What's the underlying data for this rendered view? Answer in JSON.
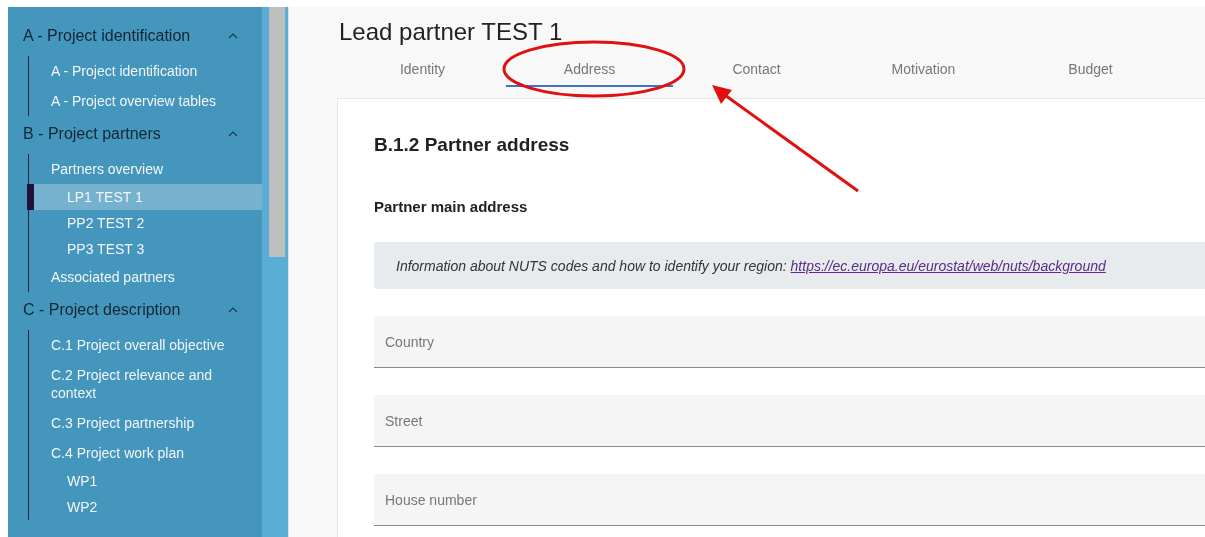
{
  "sidebar": {
    "groups": [
      {
        "label": "A - Project identification",
        "expanded": true,
        "items": [
          {
            "label": "A - Project identification",
            "selected": false
          },
          {
            "label": "A - Project overview tables",
            "selected": false
          }
        ]
      },
      {
        "label": "B - Project partners",
        "expanded": true,
        "items": [
          {
            "label": "Partners overview",
            "selected": false,
            "children": [
              {
                "label": "LP1 TEST 1",
                "selected": true
              },
              {
                "label": "PP2 TEST 2",
                "selected": false
              },
              {
                "label": "PP3 TEST 3",
                "selected": false
              }
            ]
          },
          {
            "label": "Associated partners",
            "selected": false
          }
        ]
      },
      {
        "label": "C - Project description",
        "expanded": true,
        "items": [
          {
            "label": "C.1 Project overall objective",
            "selected": false
          },
          {
            "label": "C.2 Project relevance and context",
            "selected": false
          },
          {
            "label": "C.3 Project partnership",
            "selected": false
          },
          {
            "label": "C.4 Project work plan",
            "selected": false,
            "children": [
              {
                "label": "WP1",
                "selected": false
              },
              {
                "label": "WP2",
                "selected": false
              }
            ]
          }
        ]
      }
    ]
  },
  "page": {
    "title": "Lead partner TEST 1",
    "tabs": [
      {
        "label": "Identity",
        "selected": false
      },
      {
        "label": "Address",
        "selected": true
      },
      {
        "label": "Contact",
        "selected": false
      },
      {
        "label": "Motivation",
        "selected": false
      },
      {
        "label": "Budget",
        "selected": false
      }
    ],
    "section_title": "B.1.2 Partner address",
    "subsection_title": "Partner main address",
    "info": {
      "text": "Information about NUTS codes and how to identify your region: ",
      "link": "https://ec.europa.eu/eurostat/web/nuts/background"
    },
    "fields": [
      {
        "placeholder": "Country"
      },
      {
        "placeholder": "Street"
      },
      {
        "placeholder": "House number"
      }
    ]
  },
  "annotation": {
    "kind": "ellipse_with_arrow"
  }
}
